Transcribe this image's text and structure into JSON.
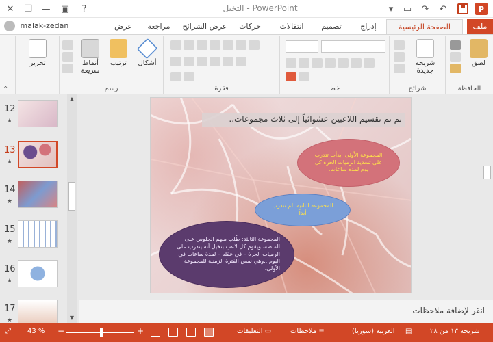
{
  "titlebar": {
    "title": "التخيل - PowerPoint",
    "help": "?",
    "app_letter": "P"
  },
  "user": {
    "name": "malak-zedan"
  },
  "tabs": [
    {
      "label": "ملف"
    },
    {
      "label": "الصفحة الرئيسية"
    },
    {
      "label": "إدراج"
    },
    {
      "label": "تصميم"
    },
    {
      "label": "انتقالات"
    },
    {
      "label": "حركات"
    },
    {
      "label": "عرض الشرائح"
    },
    {
      "label": "مراجعة"
    },
    {
      "label": "عرض"
    }
  ],
  "ribbon": {
    "clipboard": {
      "label": "الحافظة",
      "paste": "لصق"
    },
    "slides": {
      "label": "شرائح",
      "new_slide": "شريحة جديدة"
    },
    "font": {
      "label": "خط"
    },
    "paragraph": {
      "label": "فقرة"
    },
    "drawing": {
      "label": "رسم",
      "shapes": "أشكال",
      "arrange": "ترتيب",
      "styles": "أنماط سريعة"
    },
    "editing": {
      "label": "تحرير"
    }
  },
  "thumbnails": [
    {
      "num": "12",
      "star": "★"
    },
    {
      "num": "13",
      "star": "★"
    },
    {
      "num": "14",
      "star": "★"
    },
    {
      "num": "15",
      "star": "★"
    },
    {
      "num": "16",
      "star": "★"
    },
    {
      "num": "17",
      "star": "★"
    }
  ],
  "slide": {
    "title": "تم تم تقسيم اللاعبين عشوائياً إلى ثلاث مجموعات..",
    "group1": "المجموعة الأولى: بدأت تتدرب على تسديد الرميات الحرة كل يوم لمدة ساعات.",
    "group2": "المجموعة الثانية: لم تتدرب أبداً",
    "group3": "المجموعة الثالثة: طُلب منهم الجلوس على المنصة، ويقوم كل لاعب بتخيل أنه يتدرب على الرميات الحرة – في عقله – لمدة ساعات في اليوم...وهي نفس الفترة الزمنية للمجموعة الأولى."
  },
  "notes": {
    "placeholder": "انقر لإضافة ملاحظات"
  },
  "status": {
    "slide_info": "شريحة ١٣ من ٢٨",
    "language": "العربية (سوريا)",
    "notes": "ملاحظات",
    "comments": "التعليقات",
    "zoom": "43 %"
  },
  "colors": {
    "accent": "#d24726"
  }
}
